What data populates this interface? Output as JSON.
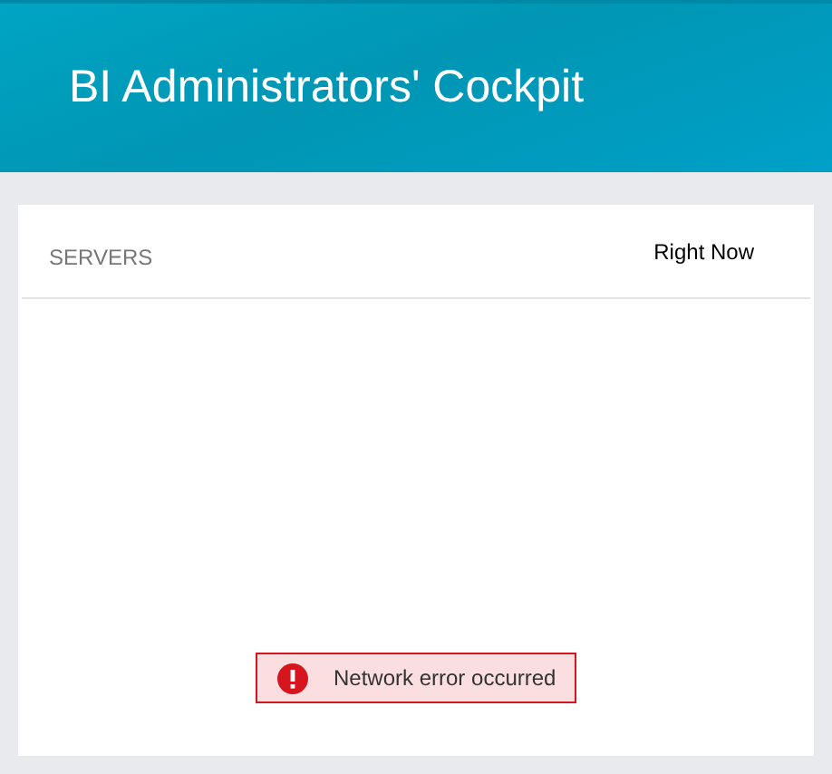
{
  "header": {
    "title": "BI Administrators' Cockpit"
  },
  "servers_card": {
    "title": "SERVERS",
    "time_range": "Right Now",
    "error": {
      "message": "Network error occurred"
    }
  }
}
